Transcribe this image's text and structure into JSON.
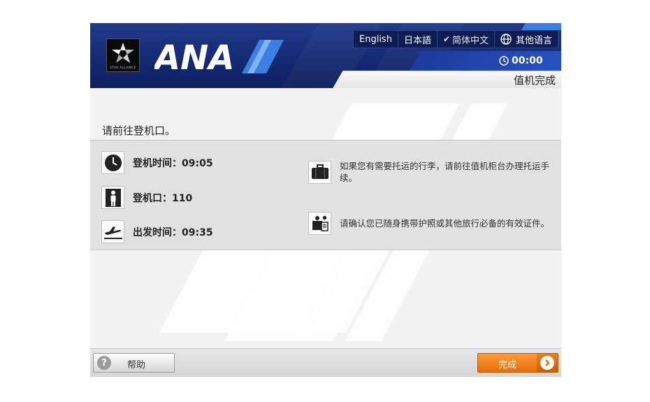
{
  "header": {
    "star_alliance_text": "STAR ALLIANCE",
    "brand": "ANA",
    "languages": [
      {
        "label": "English",
        "selected": false
      },
      {
        "label": "日本語",
        "selected": false
      },
      {
        "label": "简体中文",
        "selected": true
      },
      {
        "label": "其他语言",
        "selected": false
      }
    ],
    "timer": "00:00",
    "status": "值机完成"
  },
  "main": {
    "instruction": "请前往登机口。",
    "info": [
      {
        "icon": "clock-icon",
        "text": "登机时间：09:05"
      },
      {
        "icon": "person-gate-icon",
        "text": "登机口：110"
      },
      {
        "icon": "plane-departure-icon",
        "text": "出发时间：09:35"
      }
    ],
    "notes": [
      {
        "icon": "suitcase-icon",
        "text": "如果您有需要托运的行李，请前往值机柜台办理托运手续。"
      },
      {
        "icon": "passport-check-icon",
        "text": "请确认您已随身携带护照或其他旅行必备的有效证件。"
      }
    ]
  },
  "footer": {
    "help_label": "帮助",
    "done_label": "完成"
  },
  "colors": {
    "header_navy": "#142a73",
    "brand_accent": "#3d7fe0",
    "done_orange": "#f08421"
  }
}
